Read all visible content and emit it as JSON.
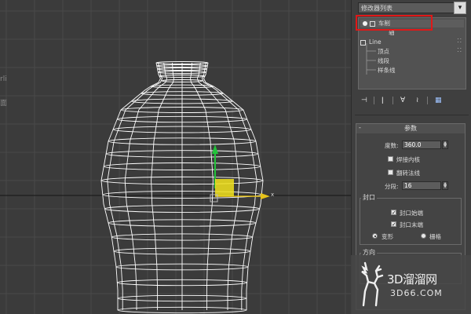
{
  "viewport": {
    "left_fragment_1": "rli",
    "left_fragment_2": "面",
    "axis_x_label": "x",
    "colors": {
      "background": "#3b3b3b",
      "grid": "#4a4a4a",
      "wireframe": "#ffffff",
      "gizmo_y": "#22c33a",
      "gizmo_x": "#e6c21a",
      "gizmo_plane": "#f2e31d"
    }
  },
  "panel": {
    "modifier_list_label": "修改器列表",
    "modifier_list_arrow": "▾",
    "stack": {
      "items": [
        {
          "label": "车削",
          "icon": "light-bulb-icon"
        },
        {
          "label": "轴",
          "icon": ""
        },
        {
          "label": "Line",
          "icon": "expand-box-icon"
        },
        {
          "label": "顶点",
          "icon": ""
        },
        {
          "label": "线段",
          "icon": ""
        },
        {
          "label": "样条线",
          "icon": ""
        }
      ]
    },
    "toolbar": {
      "pin": "⊣",
      "show_end": "ǀ",
      "make_unique": "∀",
      "remove": "≀",
      "configure": "▦"
    },
    "parameters": {
      "title": "参数",
      "collapse": "-",
      "degrees_label": "度数:",
      "degrees_value": "360.0",
      "weld_core_label": "焊接内核",
      "weld_core_checked": false,
      "flip_normals_label": "翻转法线",
      "flip_normals_checked": false,
      "segments_label": "分段:",
      "segments_value": "16",
      "capping": {
        "title": "封口",
        "cap_start_label": "封口始端",
        "cap_start_checked": true,
        "cap_end_label": "封口末端",
        "cap_end_checked": true,
        "morph_label": "变形",
        "grid_label": "栅格",
        "selected": "变形"
      },
      "direction_title": "方向"
    }
  },
  "watermark": {
    "brand": "3D溜溜网",
    "url": "3D66.COM"
  }
}
